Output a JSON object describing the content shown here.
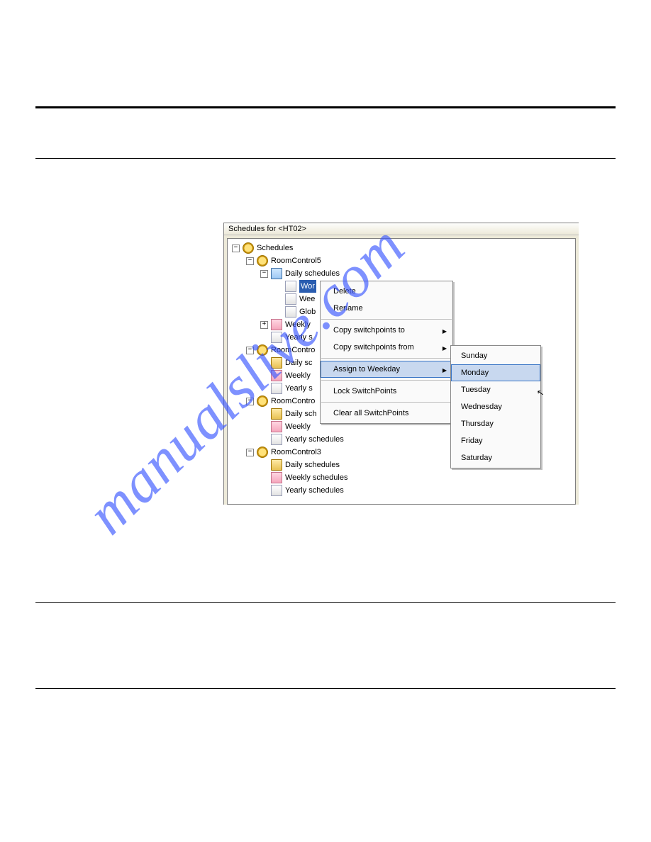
{
  "watermark": "manualslive.com",
  "window": {
    "title": "Schedules for  <HT02>",
    "tree": {
      "root": "Schedules",
      "nodes": [
        {
          "label": "RoomControl5",
          "type": "clock",
          "expander": "minus",
          "children": [
            {
              "label": "Daily schedules",
              "type": "folder-open",
              "expander": "minus",
              "children": [
                {
                  "label": "Wor",
                  "type": "item",
                  "selected": true
                },
                {
                  "label": "Wee",
                  "type": "item"
                },
                {
                  "label": "Glob",
                  "type": "item"
                }
              ]
            },
            {
              "label": "Weekly",
              "type": "item-pink",
              "expander": "plus"
            },
            {
              "label": "Yearly s",
              "type": "item"
            }
          ]
        },
        {
          "label": "RoomContro",
          "type": "clock",
          "expander": "minus",
          "children": [
            {
              "label": "Daily sc",
              "type": "folder"
            },
            {
              "label": "Weekly",
              "type": "item-pink"
            },
            {
              "label": "Yearly s",
              "type": "item"
            }
          ]
        },
        {
          "label": "RoomContro",
          "type": "clock",
          "expander": "minus",
          "children": [
            {
              "label": "Daily sch",
              "type": "folder"
            },
            {
              "label": "Weekly",
              "type": "item-pink"
            },
            {
              "label": "Yearly schedules",
              "type": "item"
            }
          ]
        },
        {
          "label": "RoomControl3",
          "type": "clock",
          "expander": "minus",
          "children": [
            {
              "label": "Daily schedules",
              "type": "folder"
            },
            {
              "label": "Weekly schedules",
              "type": "item-pink"
            },
            {
              "label": "Yearly schedules",
              "type": "item"
            }
          ]
        }
      ]
    },
    "context_menu": {
      "items": [
        {
          "label": "Delete"
        },
        {
          "label": "Rename"
        },
        {
          "sep": true
        },
        {
          "label": "Copy switchpoints to",
          "arrow": true
        },
        {
          "label": "Copy switchpoints from",
          "arrow": true
        },
        {
          "sep": true
        },
        {
          "label": "Assign to Weekday",
          "arrow": true,
          "highlight": true
        },
        {
          "sep": true
        },
        {
          "label": "Lock SwitchPoints"
        },
        {
          "sep": true
        },
        {
          "label": "Clear all SwitchPoints"
        }
      ]
    },
    "submenu": {
      "items": [
        {
          "label": "Sunday"
        },
        {
          "label": "Monday",
          "highlight": true
        },
        {
          "label": "Tuesday"
        },
        {
          "label": "Wednesday"
        },
        {
          "label": "Thursday"
        },
        {
          "label": "Friday"
        },
        {
          "label": "Saturday"
        }
      ]
    }
  }
}
